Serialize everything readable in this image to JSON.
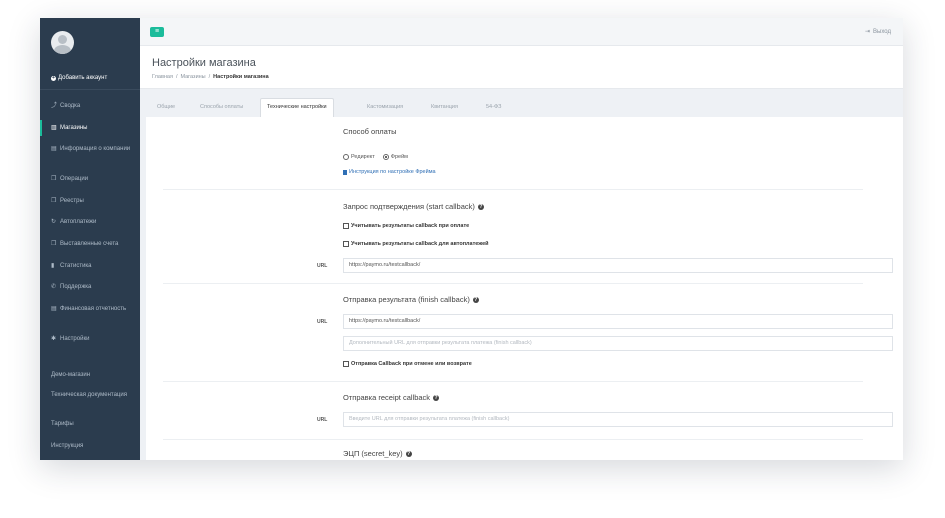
{
  "sidebar": {
    "add_account": "Добавить аккаунт",
    "items": [
      {
        "label": "Сводка",
        "icon": "chart-icon",
        "active": false
      },
      {
        "label": "Магазины",
        "icon": "bank-icon",
        "active": true
      },
      {
        "label": "Информация о компании",
        "icon": "file-icon",
        "active": false
      },
      {
        "label": "Операции",
        "icon": "copy-icon",
        "active": false
      },
      {
        "label": "Реестры",
        "icon": "copy-icon",
        "active": false
      },
      {
        "label": "Автоплатежи",
        "icon": "refresh-icon",
        "active": false
      },
      {
        "label": "Выставленные счета",
        "icon": "copy-icon",
        "active": false
      },
      {
        "label": "Статистика",
        "icon": "bar-chart-icon",
        "active": false
      },
      {
        "label": "Поддержка",
        "icon": "phone-icon",
        "active": false
      },
      {
        "label": "Финансовая отчетность",
        "icon": "file-icon",
        "active": false
      },
      {
        "label": "Настройки",
        "icon": "gear-icon",
        "active": false
      }
    ],
    "links": [
      "Демо-магазин",
      "Техническая документация",
      "Тарифы",
      "Инструкция"
    ]
  },
  "header": {
    "logout": "Выход"
  },
  "title": {
    "page_title": "Настройки магазина",
    "breadcrumb": [
      "Главная",
      "/",
      "Магазины",
      "/",
      "Настройки магазина"
    ]
  },
  "tabs": [
    {
      "label": "Общие",
      "active": false
    },
    {
      "label": "Способы оплаты",
      "active": false
    },
    {
      "label": "Технические настройки",
      "active": true
    },
    {
      "label": "Кастомизация",
      "active": false
    },
    {
      "label": "Квитанция",
      "active": false
    },
    {
      "label": "54-ФЗ",
      "active": false
    }
  ],
  "content": {
    "payment_method": {
      "title": "Способ оплаты",
      "options": [
        "Редирект",
        "Фрейм"
      ],
      "selected": "Фрейм",
      "instruction_link": "Инструкция по настройке Фрейма"
    },
    "start_callback": {
      "title": "Запрос подтверждения (start callback)",
      "check_1": "Учитывать результаты callback при оплате",
      "check_2": "Учитывать результаты callback для автоплатежей",
      "url_label": "URL",
      "url_value": "https://paymo.ru/testcallback/"
    },
    "finish_callback": {
      "title": "Отправка результата (finish callback)",
      "url_label": "URL",
      "url_value": "https://paymo.ru/testcallback/",
      "extra_placeholder": "Дополнительный URL для отправки результата платежа (finish callback)",
      "check": "Отправка Callback при отмене или возврате"
    },
    "receipt_callback": {
      "title": "Отправка receipt callback",
      "url_label": "URL",
      "url_placeholder": "Введите URL для отправки результата платежа (finish callback)"
    },
    "secret_key": {
      "title": "ЭЦП (secret_key)"
    }
  },
  "colors": {
    "sidebar_bg": "#2b3c4e",
    "accent": "#1bbc9b",
    "link": "#2f6fb5"
  }
}
